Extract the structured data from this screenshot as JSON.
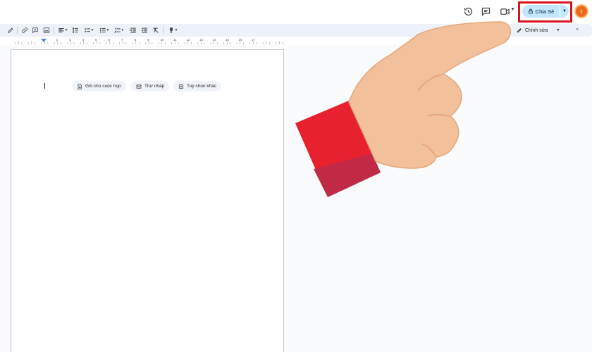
{
  "header": {
    "icons": [
      "history-icon",
      "comment-icon",
      "meet-icon"
    ],
    "share": {
      "label": "Chia Sẻ",
      "icon": "lock-icon"
    },
    "avatar": {
      "initial": "t",
      "color": "#ec6b1b"
    },
    "highlight_color": "#d9141e"
  },
  "toolbar": {
    "tools": [
      "pen-icon",
      "link-icon",
      "add-comment-icon",
      "image-icon",
      "align-icon",
      "line-spacing-icon",
      "checklist-icon",
      "bullet-list-icon",
      "numbered-list-icon",
      "decrease-indent-icon",
      "increase-indent-icon",
      "clear-formatting-icon",
      "paint-icon"
    ],
    "mode": {
      "label": "Chỉnh sửa",
      "icon": "edit-pencil-icon"
    }
  },
  "ruler": {
    "numbers": [
      "1",
      "2",
      "3",
      "4",
      "5",
      "6",
      "7",
      "8",
      "9",
      "10",
      "11",
      "12",
      "13",
      "14",
      "15",
      "16",
      "17"
    ]
  },
  "document": {
    "chips": [
      {
        "label": "Ghi chú cuộc họp",
        "icon": "document-icon"
      },
      {
        "label": "Thư nháp",
        "icon": "email-draft-icon"
      },
      {
        "label": "Tuỳ chọn khác",
        "icon": "more-options-icon"
      }
    ]
  },
  "overlay": {
    "hand_skin": "#f2c19c",
    "sleeve": "#e8212e",
    "sleeve_shadow": "#c12a45"
  }
}
